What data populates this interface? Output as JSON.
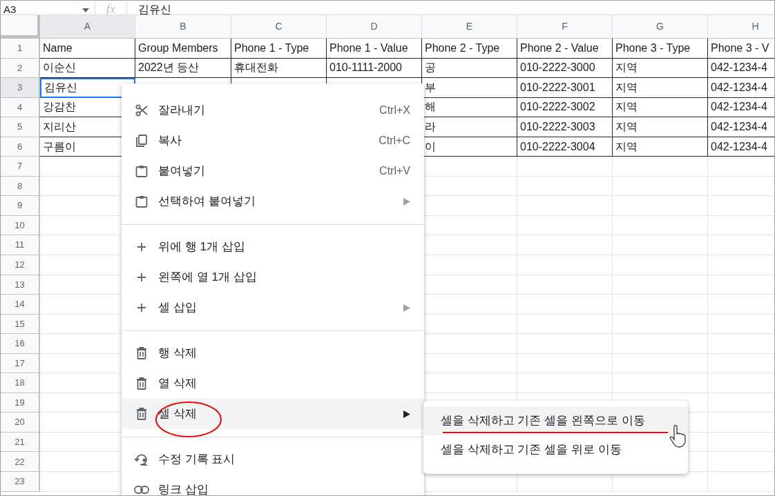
{
  "formula_bar": {
    "cell_ref": "A3",
    "fx": "fx",
    "value": "김유신"
  },
  "columns": [
    {
      "label": "A",
      "selected": true
    },
    {
      "label": "B",
      "selected": false
    },
    {
      "label": "C",
      "selected": false
    },
    {
      "label": "D",
      "selected": false
    },
    {
      "label": "E",
      "selected": false
    },
    {
      "label": "F",
      "selected": false
    },
    {
      "label": "G",
      "selected": false
    },
    {
      "label": "H",
      "selected": false
    }
  ],
  "rows": [
    {
      "number": "1",
      "selected": false,
      "cells": [
        "Name",
        "Group Members",
        "Phone 1 - Type",
        "Phone 1 - Value",
        "Phone 2 - Type",
        "Phone 2 - Value",
        "Phone 3 - Type",
        "Phone 3 - V"
      ]
    },
    {
      "number": "2",
      "selected": false,
      "cells": [
        "이순신",
        "2022년 등산",
        "휴대전화",
        "010-1111-2000",
        "공",
        "010-2222-3000",
        "지역",
        "042-1234-4"
      ]
    },
    {
      "number": "3",
      "selected": true,
      "cells": [
        "김유신",
        null,
        null,
        null,
        "부",
        "010-2222-3001",
        "지역",
        "042-1234-4"
      ]
    },
    {
      "number": "4",
      "selected": false,
      "cells": [
        "강감찬",
        null,
        null,
        null,
        "해",
        "010-2222-3002",
        "지역",
        "042-1234-4"
      ]
    },
    {
      "number": "5",
      "selected": false,
      "cells": [
        "지리산",
        null,
        null,
        null,
        "라",
        "010-2222-3003",
        "지역",
        "042-1234-4"
      ]
    },
    {
      "number": "6",
      "selected": false,
      "cells": [
        "구름이",
        null,
        null,
        null,
        "이",
        "010-2222-3004",
        "지역",
        "042-1234-4"
      ]
    },
    {
      "number": "7",
      "selected": false
    },
    {
      "number": "8",
      "selected": false
    },
    {
      "number": "9",
      "selected": false
    },
    {
      "number": "10",
      "selected": false
    },
    {
      "number": "11",
      "selected": false
    },
    {
      "number": "12",
      "selected": false
    },
    {
      "number": "13",
      "selected": false
    },
    {
      "number": "14",
      "selected": false
    },
    {
      "number": "15",
      "selected": false
    },
    {
      "number": "16",
      "selected": false
    },
    {
      "number": "17",
      "selected": false
    },
    {
      "number": "18",
      "selected": false
    },
    {
      "number": "19",
      "selected": false
    },
    {
      "number": "20",
      "selected": false
    },
    {
      "number": "21",
      "selected": false
    },
    {
      "number": "22",
      "selected": false
    },
    {
      "number": "23",
      "selected": false
    }
  ],
  "context_menu": [
    {
      "kind": "cut",
      "label": "잘라내기",
      "shortcut": "Ctrl+X",
      "submenu": false,
      "selected": false
    },
    {
      "kind": "copy",
      "label": "복사",
      "shortcut": "Ctrl+C",
      "submenu": false,
      "selected": false
    },
    {
      "kind": "paste",
      "label": "붙여넣기",
      "shortcut": "Ctrl+V",
      "submenu": false,
      "selected": false
    },
    {
      "kind": "paste",
      "label": "선택하여 붙여넣기",
      "submenu": true,
      "selected": false
    },
    {
      "kind": "divider"
    },
    {
      "kind": "insert",
      "label": "위에 행 1개 삽입",
      "submenu": false,
      "selected": false
    },
    {
      "kind": "insert",
      "label": "왼쪽에 열 1개 삽입",
      "submenu": false,
      "selected": false
    },
    {
      "kind": "insert",
      "label": "셀 삽입",
      "submenu": true,
      "selected": false
    },
    {
      "kind": "divider"
    },
    {
      "kind": "delete",
      "label": "행 삭제",
      "submenu": false,
      "selected": false
    },
    {
      "kind": "delete",
      "label": "열 삭제",
      "submenu": false,
      "selected": false
    },
    {
      "kind": "delete",
      "label": "셀 삭제",
      "submenu": true,
      "selected": true
    },
    {
      "kind": "divider"
    },
    {
      "kind": "history",
      "label": "수정 기록 표시",
      "submenu": false,
      "selected": false
    },
    {
      "kind": "link",
      "label": "링크 삽입",
      "submenu": false,
      "selected": false
    }
  ],
  "submenu": [
    {
      "label": "셀을 삭제하고 기존 셀을 왼쪽으로 이동",
      "selected": true
    },
    {
      "label": "셀을 삭제하고 기존 셀을 위로 이동",
      "selected": false
    }
  ]
}
